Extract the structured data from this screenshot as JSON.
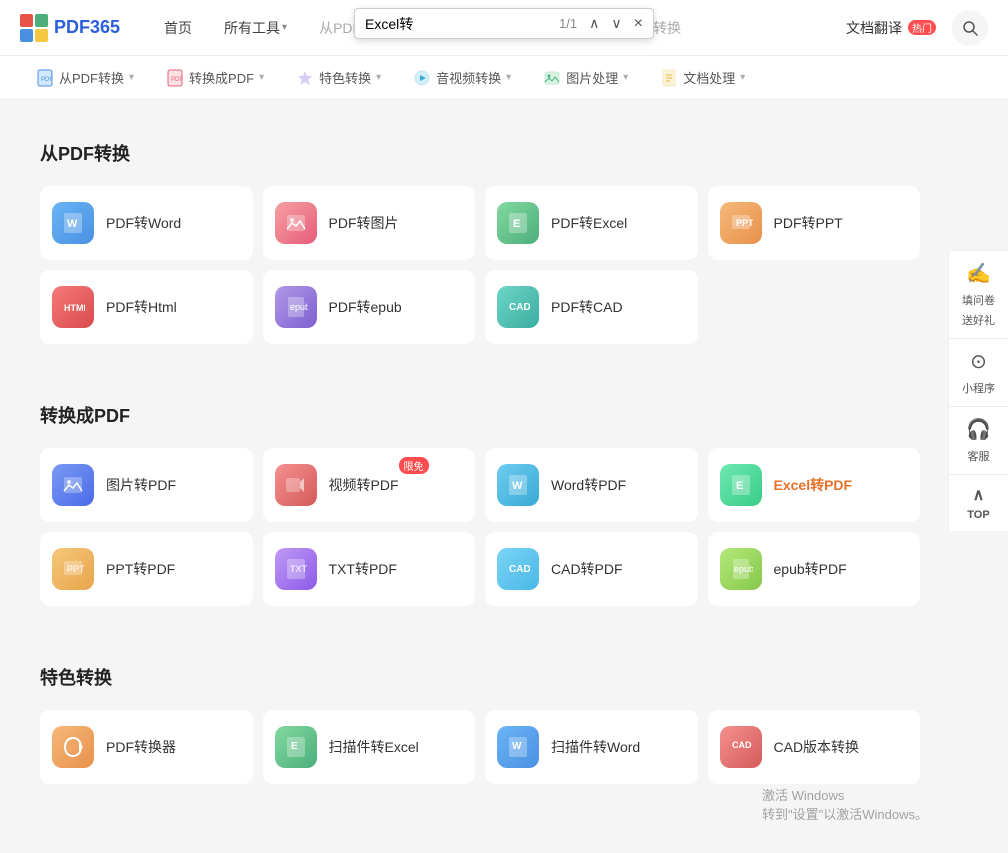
{
  "app": {
    "name": "PDF365",
    "logo_text": "PDF365"
  },
  "top_nav": {
    "home": "首页",
    "all_tools": "所有工具",
    "all_tools_arrow": "▾",
    "from_pdf": "从PDF转换",
    "to_pdf": "转换成PDF",
    "special": "特色转换",
    "audio_video": "音视频转换",
    "image_process": "图片处理",
    "doc_process": "文档处理",
    "doc_translate": "文档翻译",
    "hot_label": "热门"
  },
  "search_bar": {
    "keyword": "Excel转",
    "page_info": "1/1",
    "up_arrow": "∧",
    "down_arrow": "∨",
    "close": "×"
  },
  "sub_nav": {
    "items": [
      {
        "icon": "📄",
        "label": "从PDF转换",
        "arrow": "▾"
      },
      {
        "icon": "📋",
        "label": "转换成PDF",
        "arrow": "▾"
      },
      {
        "icon": "🔒",
        "label": "特色转换",
        "arrow": "▾"
      },
      {
        "icon": "🎵",
        "label": "音视频转换",
        "arrow": "▾"
      },
      {
        "icon": "🖼",
        "label": "图片处理",
        "arrow": "▾"
      },
      {
        "icon": "📝",
        "label": "文档处理",
        "arrow": "▾"
      }
    ]
  },
  "sections": [
    {
      "id": "from_pdf",
      "title": "从PDF转换",
      "tools": [
        {
          "name": "PDF转Word",
          "icon": "W",
          "color": "icon-blue-light"
        },
        {
          "name": "PDF转图片",
          "icon": "🖼",
          "color": "icon-pink"
        },
        {
          "name": "PDF转Excel",
          "icon": "E",
          "color": "icon-green"
        },
        {
          "name": "PDF转PPT",
          "icon": "P",
          "color": "icon-orange"
        },
        {
          "name": "PDF转Html",
          "icon": "H",
          "color": "icon-red"
        },
        {
          "name": "PDF转epub",
          "icon": "e",
          "color": "icon-purple"
        },
        {
          "name": "PDF转CAD",
          "icon": "C",
          "color": "icon-teal"
        }
      ]
    },
    {
      "id": "to_pdf",
      "title": "转换成PDF",
      "tools": [
        {
          "name": "图片转PDF",
          "icon": "🖼",
          "color": "icon-indigo"
        },
        {
          "name": "视频转PDF",
          "icon": "▶",
          "color": "icon-rose",
          "badge": "限免"
        },
        {
          "name": "Word转PDF",
          "icon": "W",
          "color": "icon-cyan"
        },
        {
          "name": "Excel转PDF",
          "icon": "E",
          "color": "icon-emerald",
          "highlight": true
        },
        {
          "name": "PPT转PDF",
          "icon": "P",
          "color": "icon-amber"
        },
        {
          "name": "TXT转PDF",
          "icon": "T",
          "color": "icon-violet"
        },
        {
          "name": "CAD转PDF",
          "icon": "C",
          "color": "icon-sky"
        },
        {
          "name": "epub转PDF",
          "icon": "e",
          "color": "icon-lime"
        }
      ]
    },
    {
      "id": "special",
      "title": "特色转换",
      "tools": [
        {
          "name": "PDF转换器",
          "icon": "🔄",
          "color": "icon-orange"
        },
        {
          "name": "扫描件转Excel",
          "icon": "E",
          "color": "icon-green"
        },
        {
          "name": "扫描件转Word",
          "icon": "W",
          "color": "icon-blue-light"
        },
        {
          "name": "CAD版本转换",
          "icon": "C",
          "color": "icon-rose"
        }
      ]
    }
  ],
  "right_panel": {
    "feedback": {
      "icon": "✍",
      "lines": [
        "填问卷",
        "送好礼"
      ]
    },
    "mini_app": {
      "icon": "⊙",
      "label": "小程序"
    },
    "service": {
      "icon": "🎧",
      "label": "客服"
    },
    "top": {
      "icon": "∧",
      "label": "TOP"
    }
  },
  "watermark": {
    "line1": "激活 Windows",
    "line2": "转到\"设置\"以激活Windows。"
  }
}
